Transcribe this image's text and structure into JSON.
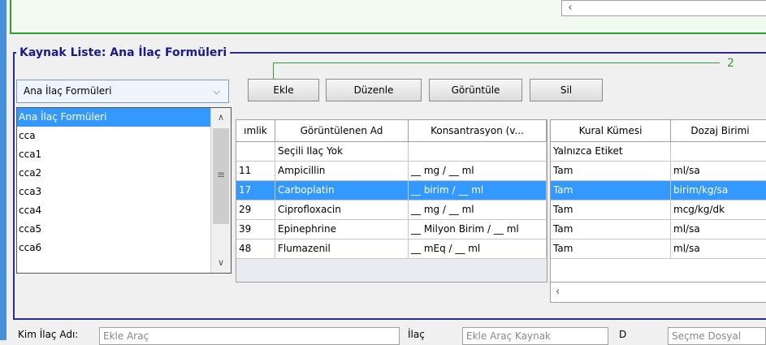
{
  "group": {
    "title": "Kaynak Liste: Ana İlaç Formüleri",
    "callout": "2"
  },
  "combo": {
    "value": "Ana İlaç Formüleri",
    "options": [
      "Ana İlaç Formüleri",
      "cca",
      "cca1",
      "cca2",
      "cca3",
      "cca4",
      "cca5",
      "cca6"
    ]
  },
  "buttons": {
    "add": "Ekle",
    "edit": "Düzenle",
    "view": "Görüntüle",
    "delete": "Sil"
  },
  "left_table": {
    "headers": [
      "ımlik",
      "Görüntülenen Ad",
      "Konsantrasyon (v..."
    ],
    "rows": [
      {
        "id": "",
        "name": "Seçili Ilaç Yok",
        "conc": ""
      },
      {
        "id": "11",
        "name": "Ampicillin",
        "conc": "__ mg / __ ml"
      },
      {
        "id": "17",
        "name": "Carboplatin",
        "conc": "__ birim / __ ml"
      },
      {
        "id": "29",
        "name": "Ciprofloxacin",
        "conc": "__ mg / __ ml"
      },
      {
        "id": "39",
        "name": "Epinephrine",
        "conc": "__ Milyon Birim / __ ml"
      },
      {
        "id": "48",
        "name": "Flumazenil",
        "conc": "__ mEq / __ ml"
      }
    ],
    "selected_index": 2
  },
  "right_table": {
    "headers": [
      "Kural Kümesi",
      "Dozaj Birimi"
    ],
    "rows": [
      {
        "rule": "Yalnızca Etiket",
        "dose": ""
      },
      {
        "rule": "Tam",
        "dose": "ml/sa"
      },
      {
        "rule": "Tam",
        "dose": "birim/kg/sa"
      },
      {
        "rule": "Tam",
        "dose": "mcg/kg/dk"
      },
      {
        "rule": "Tam",
        "dose": "ml/sa"
      },
      {
        "rule": "Tam",
        "dose": "ml/sa"
      }
    ]
  },
  "bottom": {
    "label1": "Kim İlaç Adı:",
    "field1": "Ekle Araç",
    "label2": "İlaç",
    "field2": "Ekle Araç Kaynak",
    "label3": "D",
    "field3": "Seçme Dosyal"
  }
}
